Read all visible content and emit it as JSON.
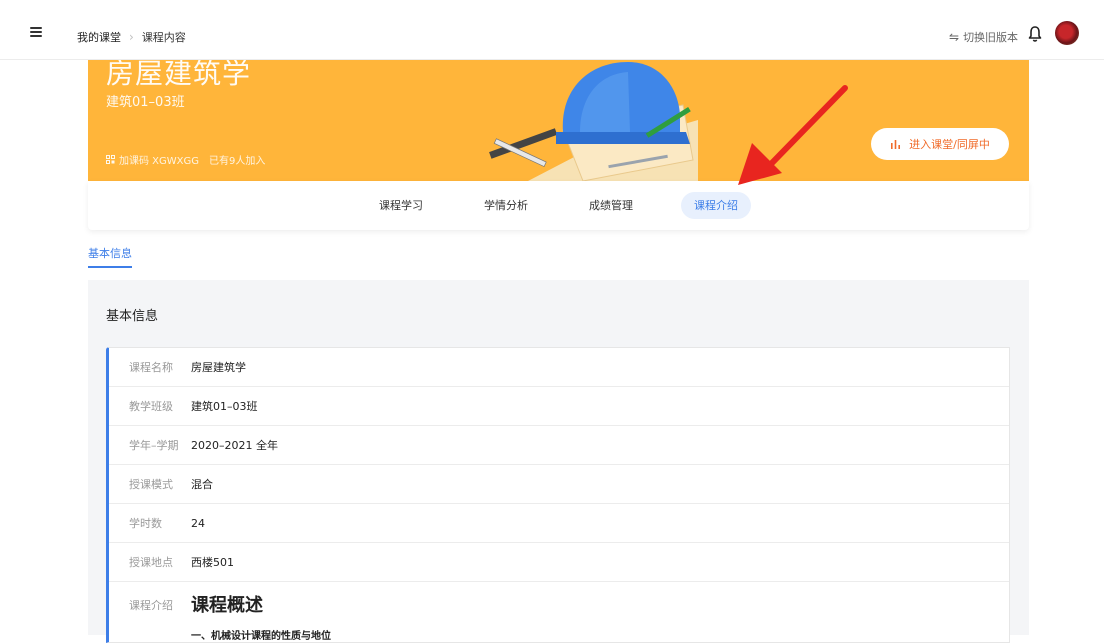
{
  "breadcrumb": {
    "item1": "我的课堂",
    "item2": "课程内容"
  },
  "header": {
    "switch_old_label": "切换旧版本",
    "switch_icon": "⇋"
  },
  "banner": {
    "course_title": "房屋建筑学",
    "class_name": "建筑01–03班",
    "join_code": "加课码 XGWXGG",
    "joined_count": "已有9人加入",
    "enter_button": "进入课堂/同屏中",
    "bg_color": "#ffb53a"
  },
  "tabs": [
    {
      "label": "课程学习"
    },
    {
      "label": "学情分析"
    },
    {
      "label": "成绩管理"
    },
    {
      "label": "课程介绍",
      "active": true
    }
  ],
  "subtab": {
    "label": "基本信息"
  },
  "section": {
    "title": "基本信息"
  },
  "info": [
    {
      "label": "课程名称",
      "value": "房屋建筑学"
    },
    {
      "label": "教学班级",
      "value": "建筑01–03班"
    },
    {
      "label": "学年–学期",
      "value": "2020–2021 全年"
    },
    {
      "label": "授课模式",
      "value": "混合"
    },
    {
      "label": "学时数",
      "value": "24"
    },
    {
      "label": "授课地点",
      "value": "西楼501"
    }
  ],
  "intro": {
    "label": "课程介绍",
    "heading": "课程概述",
    "subheading": "一、机械设计课程的性质与地位"
  },
  "accent_color": "#3d7ee8"
}
